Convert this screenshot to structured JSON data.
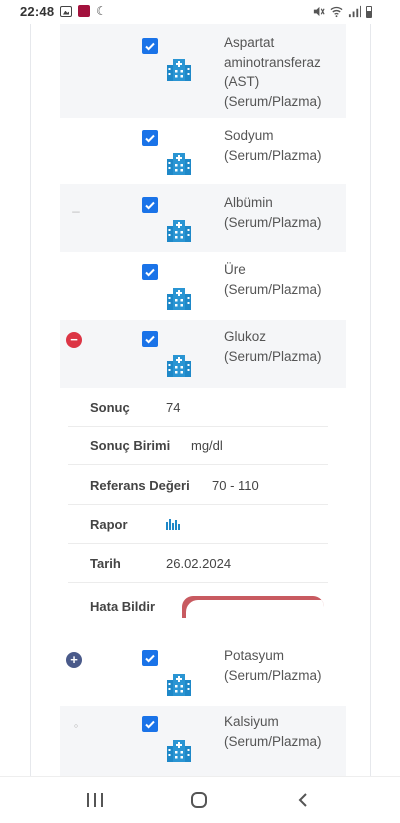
{
  "status_bar": {
    "time": "22:48"
  },
  "tests": [
    {
      "name": "Aspartat\naminotransferaz\n(AST)\n(Serum/Plazma)",
      "checked": true,
      "toggle": ""
    },
    {
      "name": "Sodyum\n(Serum/Plazma)",
      "checked": true,
      "toggle": ""
    },
    {
      "name": "Albümin\n(Serum/Plazma)",
      "checked": true,
      "toggle": ""
    },
    {
      "name": "Üre\n(Serum/Plazma)",
      "checked": true,
      "toggle": ""
    },
    {
      "name": "Glukoz\n(Serum/Plazma)",
      "checked": true,
      "toggle": "−"
    },
    {
      "name": "Potasyum\n(Serum/Plazma)",
      "checked": true,
      "toggle": "+"
    },
    {
      "name": "Kalsiyum\n(Serum/Plazma)",
      "checked": true,
      "toggle": ""
    }
  ],
  "detail": {
    "sonuc_label": "Sonuç",
    "sonuc_value": "74",
    "birim_label": "Sonuç Birimi",
    "birim_value": "mg/dl",
    "referans_label": "Referans Değeri",
    "referans_value": "70 - 110",
    "rapor_label": "Rapor",
    "rapor_icon": "bar-chart-icon",
    "tarih_label": "Tarih",
    "tarih_value": "26.02.2024",
    "hata_label": "Hata Bildir"
  },
  "colors": {
    "checkbox": "#1a73e8",
    "hospital_icon": "#1e88c8",
    "toggle_minus": "#dc3545",
    "toggle_plus": "#4a5a8a",
    "error_button": "#c85a60"
  }
}
